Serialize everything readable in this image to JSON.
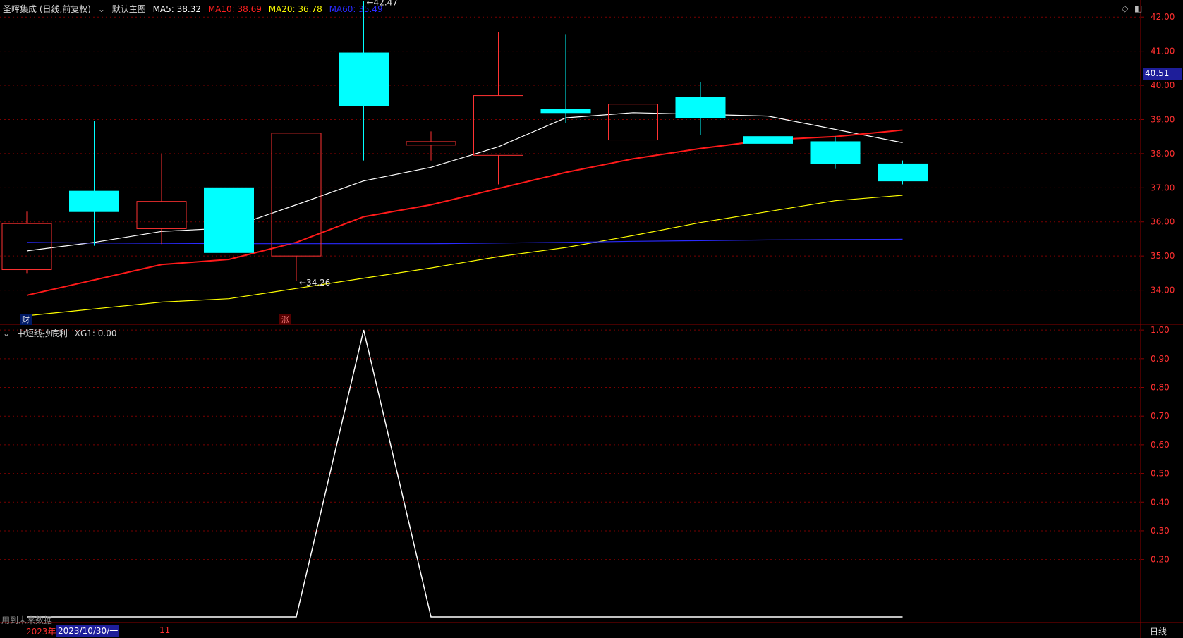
{
  "header": {
    "title": "圣晖集成 (日线,前复权)",
    "tool": "默认主图",
    "ma": [
      {
        "label": "MA5: 38.32",
        "color": "#ffffff"
      },
      {
        "label": "MA10: 38.69",
        "color": "#ff2020"
      },
      {
        "label": "MA20: 36.78",
        "color": "#ffff00"
      },
      {
        "label": "MA60: 35.49",
        "color": "#2a2aff"
      }
    ]
  },
  "sub_header": {
    "title": "中短线抄底利",
    "value": "XG1: 0.00"
  },
  "current_price_tag": "40.51",
  "markers": {
    "cai": "财",
    "zhang": "涨"
  },
  "footer": {
    "notice": "用到未来数据",
    "year": "2023年",
    "date": "2023/10/30/一",
    "month": "11",
    "period": "日线"
  },
  "colors": {
    "up": "#ff3232",
    "down": "#00ffff",
    "axis": "#8b0000",
    "grid": "#7a0000"
  },
  "chart_data": [
    {
      "type": "candlestick",
      "ylim": [
        33.0,
        42.5
      ],
      "yticks": [
        "42.00",
        "41.00",
        "40.00",
        "39.00",
        "38.00",
        "37.00",
        "36.00",
        "35.00",
        "34.00"
      ],
      "candles": [
        {
          "open": 34.6,
          "close": 35.95,
          "high": 36.3,
          "low": 34.5
        },
        {
          "open": 36.9,
          "close": 36.3,
          "high": 38.95,
          "low": 35.3
        },
        {
          "open": 35.8,
          "close": 36.6,
          "high": 38.0,
          "low": 35.35
        },
        {
          "open": 37.0,
          "close": 35.1,
          "high": 38.2,
          "low": 35.0
        },
        {
          "open": 35.0,
          "close": 38.6,
          "high": 38.6,
          "low": 34.26
        },
        {
          "open": 40.95,
          "close": 39.4,
          "high": 42.47,
          "low": 37.8
        },
        {
          "open": 38.25,
          "close": 38.35,
          "high": 38.65,
          "low": 37.8
        },
        {
          "open": 37.95,
          "close": 39.7,
          "high": 41.55,
          "low": 37.1
        },
        {
          "open": 39.3,
          "close": 39.2,
          "high": 41.5,
          "low": 38.9
        },
        {
          "open": 38.4,
          "close": 39.45,
          "high": 40.5,
          "low": 38.1
        },
        {
          "open": 39.65,
          "close": 39.05,
          "high": 40.1,
          "low": 38.55
        },
        {
          "open": 38.5,
          "close": 38.3,
          "high": 38.95,
          "low": 37.65
        },
        {
          "open": 38.35,
          "close": 37.7,
          "high": 38.5,
          "low": 37.55
        },
        {
          "open": 37.7,
          "close": 37.2,
          "high": 37.8,
          "low": 37.1
        }
      ],
      "annotations": [
        {
          "index": 5,
          "value": 42.47,
          "label": "42.47"
        },
        {
          "index": 4,
          "value": 34.26,
          "label": "34.26"
        }
      ],
      "series": [
        {
          "name": "MA5",
          "color": "#ffffff",
          "width": 1.2,
          "values": [
            35.15,
            35.4,
            35.72,
            35.82,
            36.5,
            37.2,
            37.6,
            38.2,
            39.05,
            39.2,
            39.15,
            39.1,
            null,
            38.32
          ]
        },
        {
          "name": "MA10",
          "color": "#ff1a1a",
          "width": 2,
          "values": [
            33.85,
            34.3,
            34.75,
            34.9,
            35.4,
            36.15,
            36.5,
            36.98,
            37.45,
            37.85,
            38.15,
            38.4,
            38.5,
            38.69
          ]
        },
        {
          "name": "MA20",
          "color": "#ffff00",
          "width": 1.2,
          "values": [
            33.25,
            33.45,
            33.65,
            33.75,
            34.05,
            34.35,
            34.65,
            34.98,
            35.25,
            35.6,
            35.98,
            36.3,
            36.62,
            36.78
          ]
        },
        {
          "name": "MA60",
          "color": "#2a2aff",
          "width": 1.2,
          "values": [
            35.4,
            35.38,
            35.37,
            35.36,
            35.36,
            35.36,
            35.36,
            35.38,
            35.4,
            35.43,
            35.45,
            35.47,
            35.48,
            35.49
          ]
        }
      ]
    },
    {
      "type": "line",
      "ylim": [
        0.0,
        1.02
      ],
      "yticks": [
        "1.00",
        "0.90",
        "0.80",
        "0.70",
        "0.60",
        "0.50",
        "0.40",
        "0.30",
        "0.20"
      ],
      "series": [
        {
          "name": "XG1",
          "color": "#ffffff",
          "values": [
            0,
            0,
            0,
            0,
            0,
            1,
            0,
            0,
            0,
            0,
            0,
            0,
            0,
            0
          ]
        }
      ]
    }
  ]
}
